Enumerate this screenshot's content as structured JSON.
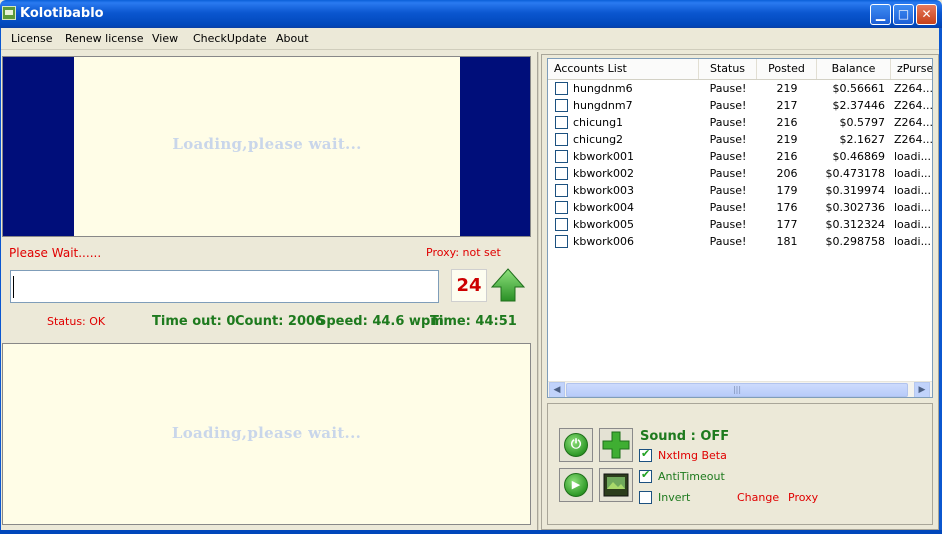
{
  "window": {
    "title": "Kolotibablo",
    "min": "▁",
    "max": "□",
    "close": "✕"
  },
  "menu": [
    {
      "label": "License"
    },
    {
      "label": "Renew license"
    },
    {
      "label": "View"
    },
    {
      "label": "CheckUpdate"
    },
    {
      "label": "About"
    }
  ],
  "captcha": {
    "loading_top": "Loading,please wait...",
    "loading_bottom": "Loading,please wait...",
    "please_wait": "Please Wait......",
    "proxy": "Proxy: not set",
    "answer_value": "",
    "counter": "24"
  },
  "status": {
    "status": "Status: OK",
    "timeout": "Time out: 0",
    "count": "Count: 2006",
    "speed": "Speed: 44.6 wpm",
    "time": "Time: 44:51"
  },
  "accounts": {
    "headers": [
      "Accounts List",
      "Status",
      "Posted",
      "Balance",
      "zPurse"
    ],
    "rows": [
      {
        "name": "hungdnm6",
        "status": "Pause!",
        "posted": "219",
        "balance": "$0.56661",
        "zpurse": "Z264..."
      },
      {
        "name": "hungdnm7",
        "status": "Pause!",
        "posted": "217",
        "balance": "$2.37446",
        "zpurse": "Z264..."
      },
      {
        "name": "chicung1",
        "status": "Pause!",
        "posted": "216",
        "balance": "$0.5797",
        "zpurse": "Z264..."
      },
      {
        "name": "chicung2",
        "status": "Pause!",
        "posted": "219",
        "balance": "$2.1627",
        "zpurse": "Z264..."
      },
      {
        "name": "kbwork001",
        "status": "Pause!",
        "posted": "216",
        "balance": "$0.46869",
        "zpurse": "loadi..."
      },
      {
        "name": "kbwork002",
        "status": "Pause!",
        "posted": "206",
        "balance": "$0.473178",
        "zpurse": "loadi..."
      },
      {
        "name": "kbwork003",
        "status": "Pause!",
        "posted": "179",
        "balance": "$0.319974",
        "zpurse": "loadi..."
      },
      {
        "name": "kbwork004",
        "status": "Pause!",
        "posted": "176",
        "balance": "$0.302736",
        "zpurse": "loadi..."
      },
      {
        "name": "kbwork005",
        "status": "Pause!",
        "posted": "177",
        "balance": "$0.312324",
        "zpurse": "loadi..."
      },
      {
        "name": "kbwork006",
        "status": "Pause!",
        "posted": "181",
        "balance": "$0.298758",
        "zpurse": "loadi..."
      }
    ],
    "scroll_left": "◀",
    "scroll_right": "▶",
    "scroll_grip": "|||"
  },
  "controls": {
    "sound": "Sound : OFF",
    "nxtimg": "NxtImg Beta",
    "antitimeout": "AntiTimeout",
    "invert": "Invert",
    "change": "Change",
    "proxy": "Proxy",
    "nxtimg_checked": true,
    "antitimeout_checked": true,
    "invert_checked": false,
    "power_glyph": "⏻",
    "play_glyph": "▶",
    "add_glyph": "+"
  },
  "colors": {
    "title_bar": "#0b57d0",
    "captcha_bg": "#000e7a",
    "captcha_frame": "#fffde7",
    "red_text": "#e00000",
    "green_text": "#1e7a1e",
    "counter_red": "#cc0000"
  }
}
